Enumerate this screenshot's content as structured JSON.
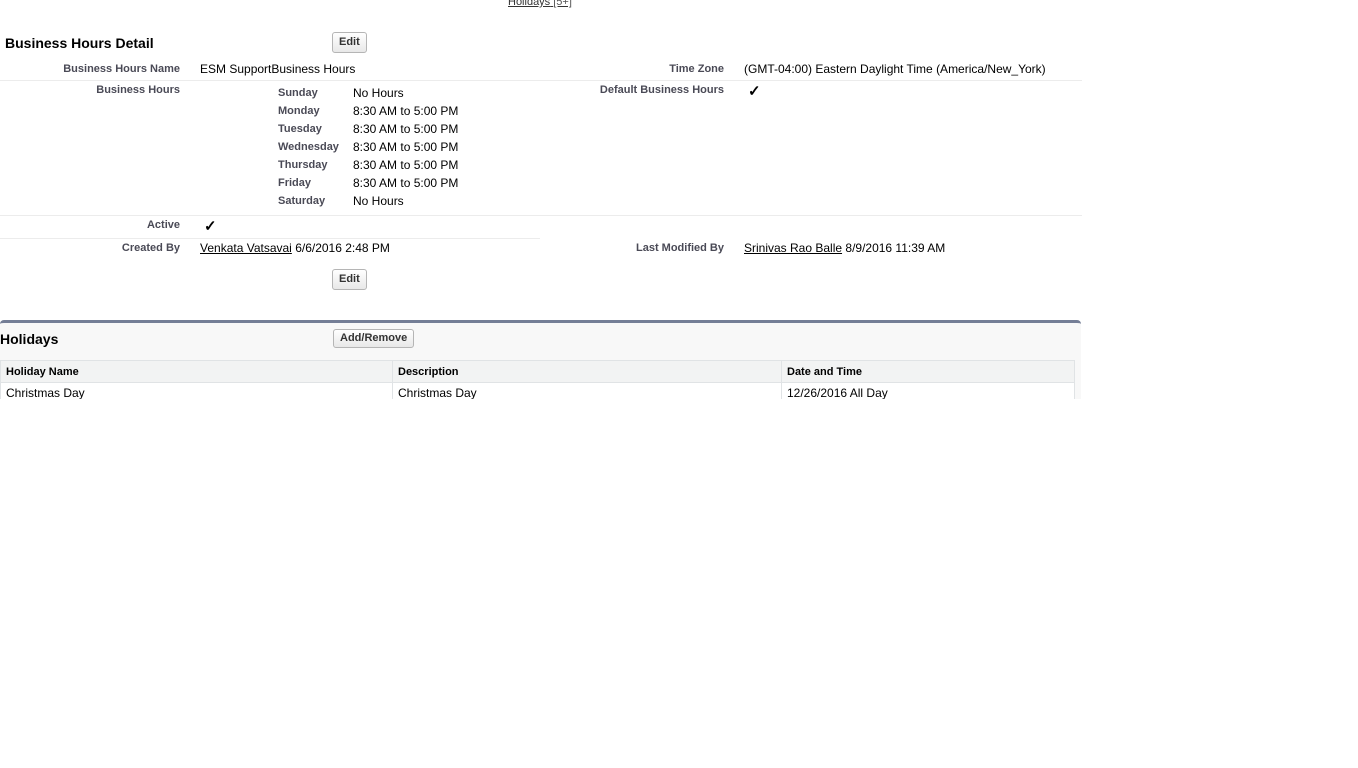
{
  "top_link": {
    "label": "Holidays",
    "count": "[5+]"
  },
  "detail": {
    "title": "Business Hours Detail",
    "edit_label": "Edit",
    "name_label": "Business Hours Name",
    "name_value": "ESM SupportBusiness Hours",
    "timezone_label": "Time Zone",
    "timezone_value": "(GMT-04:00) Eastern Daylight Time (America/New_York)",
    "hours_label": "Business Hours",
    "default_label": "Default Business Hours",
    "default_checked": true,
    "days": [
      {
        "day": "Sunday",
        "hours": "No Hours"
      },
      {
        "day": "Monday",
        "hours": "8:30 AM to 5:00 PM"
      },
      {
        "day": "Tuesday",
        "hours": "8:30 AM to 5:00 PM"
      },
      {
        "day": "Wednesday",
        "hours": "8:30 AM to 5:00 PM"
      },
      {
        "day": "Thursday",
        "hours": "8:30 AM to 5:00 PM"
      },
      {
        "day": "Friday",
        "hours": "8:30 AM to 5:00 PM"
      },
      {
        "day": "Saturday",
        "hours": "No Hours"
      }
    ],
    "active_label": "Active",
    "active_checked": true,
    "created_by_label": "Created By",
    "created_by_user": "Venkata Vatsavai",
    "created_by_date": "6/6/2016 2:48 PM",
    "modified_by_label": "Last Modified By",
    "modified_by_user": "Srinivas Rao Balle",
    "modified_by_date": "8/9/2016 11:39 AM",
    "check_glyph": "✓"
  },
  "holidays": {
    "title": "Holidays",
    "add_remove_label": "Add/Remove",
    "columns": [
      "Holiday Name",
      "Description",
      "Date and Time"
    ],
    "rows": [
      {
        "name": "Christmas Day",
        "description": "Christmas Day",
        "datetime": "12/26/2016 All Day"
      }
    ]
  }
}
